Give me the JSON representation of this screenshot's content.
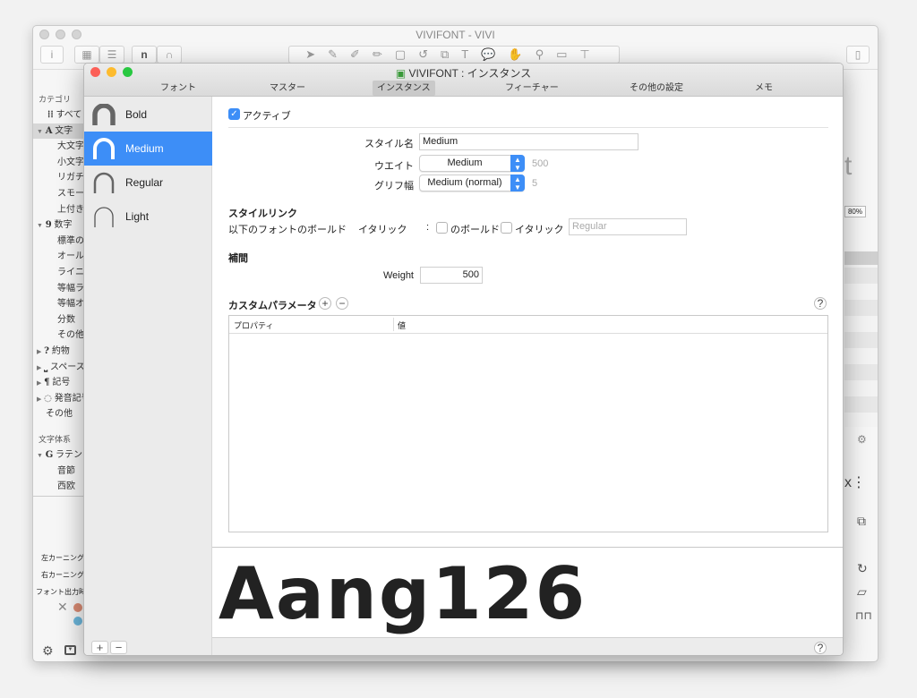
{
  "bg_window": {
    "title": "VIVIFONT - VIVI",
    "categories_header": "カテゴリ",
    "categories": [
      {
        "label": "すべて",
        "icon": "grid-icon",
        "indent": 1
      },
      {
        "label": "文字",
        "icon": "A-glyph-icon",
        "arrow": "▼"
      },
      {
        "label": "大文字",
        "indent": 2
      },
      {
        "label": "小文字",
        "indent": 2
      },
      {
        "label": "リガチャ",
        "indent": 2
      },
      {
        "label": "スモール",
        "indent": 2
      },
      {
        "label": "上付き",
        "indent": 2
      },
      {
        "label": "数字",
        "icon": "9-glyph-icon",
        "arrow": "▼"
      },
      {
        "label": "標準の",
        "indent": 2
      },
      {
        "label": "オール",
        "indent": 2
      },
      {
        "label": "ライニ",
        "indent": 2
      },
      {
        "label": "等幅ラ",
        "indent": 2
      },
      {
        "label": "等幅オ",
        "indent": 2
      },
      {
        "label": "分数",
        "indent": 2
      },
      {
        "label": "その他",
        "indent": 2
      },
      {
        "label": "約物",
        "icon": "question-glyph-icon",
        "arrow": "▶"
      },
      {
        "label": "スペース",
        "icon": "space-icon",
        "arrow": "▶"
      },
      {
        "label": "記号",
        "icon": "pilcrow-icon",
        "arrow": "▶"
      },
      {
        "label": "発音記号",
        "icon": "diacritic-icon",
        "arrow": "▶"
      },
      {
        "label": "その他",
        "indent": 0
      }
    ],
    "scripts_header": "文字体系",
    "scripts": [
      {
        "label": "ラテン",
        "icon": "G-glyph-icon",
        "arrow": "▼"
      },
      {
        "label": "音節",
        "indent": 2
      },
      {
        "label": "西欧",
        "indent": 2
      }
    ],
    "left_kerning": "左カーニング",
    "right_kerning": "右カーニング",
    "export_label": "フォント出力時",
    "zoom": "80%"
  },
  "window": {
    "title": "VIVIFONT : インスタンス",
    "tabs": [
      "フォント",
      "マスター",
      "インスタンス",
      "フィーチャー",
      "その他の設定",
      "メモ"
    ],
    "selected_tab": "インスタンス",
    "instances": [
      "Bold",
      "Medium",
      "Regular",
      "Light"
    ],
    "selected_instance": "Medium",
    "active_label": "アクティブ",
    "active_checked": true,
    "style_name_label": "スタイル名",
    "style_name": "Medium",
    "weight_label": "ウエイト",
    "weight_value": "Medium",
    "weight_class": "500",
    "width_label": "グリフ幅",
    "width_value": "Medium (normal)",
    "width_class": "5",
    "style_linking_header": "スタイルリンク",
    "style_linking_text1": "以下のフォントのボールド",
    "style_linking_text2": "イタリック",
    "style_linking_colon": ":",
    "bold_label": "のボールド",
    "italic_label": "イタリック",
    "linked_style_placeholder": "Regular",
    "interpolation_header": "補間",
    "weight_axis_label": "Weight",
    "weight_axis_value": "500",
    "custom_params_header": "カスタムパラメータ",
    "table_headers": [
      "プロパティ",
      "値"
    ],
    "preview_text": "Aang126",
    "accent": "#3d8ef7"
  }
}
